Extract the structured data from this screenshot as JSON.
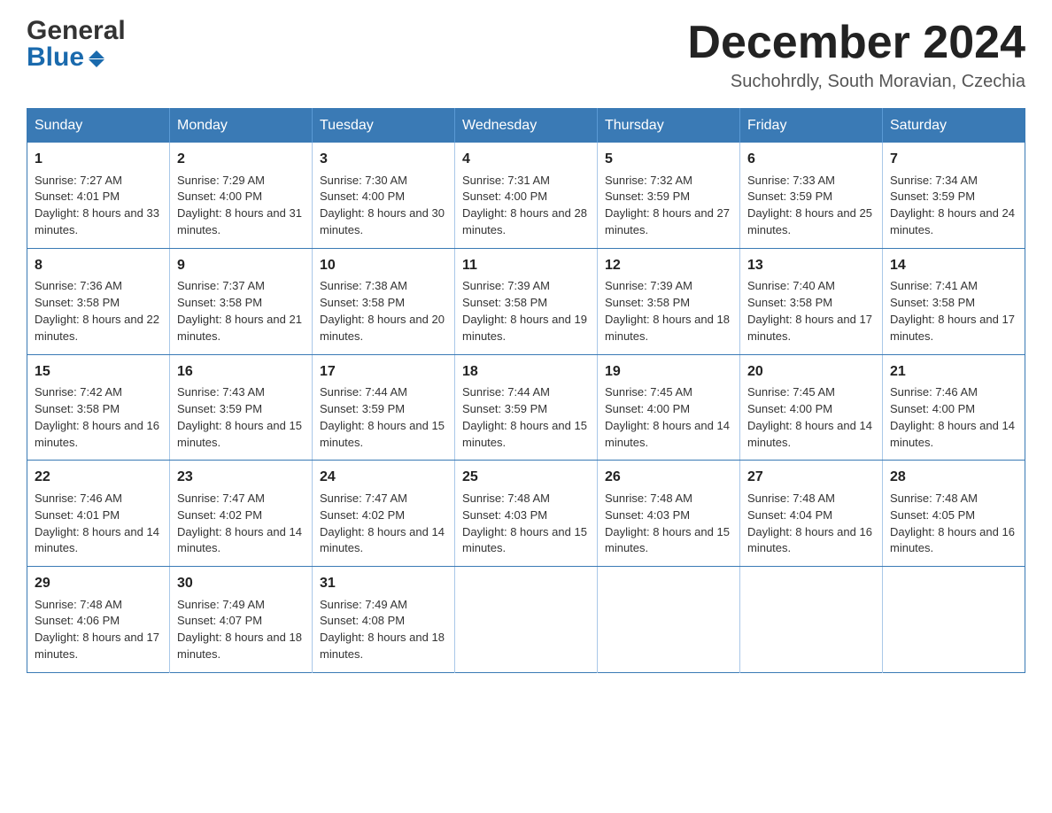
{
  "header": {
    "logo_line1": "General",
    "logo_line2": "Blue",
    "month_title": "December 2024",
    "location": "Suchohrdly, South Moravian, Czechia"
  },
  "weekdays": [
    "Sunday",
    "Monday",
    "Tuesday",
    "Wednesday",
    "Thursday",
    "Friday",
    "Saturday"
  ],
  "weeks": [
    [
      {
        "day": "1",
        "sunrise": "Sunrise: 7:27 AM",
        "sunset": "Sunset: 4:01 PM",
        "daylight": "Daylight: 8 hours and 33 minutes."
      },
      {
        "day": "2",
        "sunrise": "Sunrise: 7:29 AM",
        "sunset": "Sunset: 4:00 PM",
        "daylight": "Daylight: 8 hours and 31 minutes."
      },
      {
        "day": "3",
        "sunrise": "Sunrise: 7:30 AM",
        "sunset": "Sunset: 4:00 PM",
        "daylight": "Daylight: 8 hours and 30 minutes."
      },
      {
        "day": "4",
        "sunrise": "Sunrise: 7:31 AM",
        "sunset": "Sunset: 4:00 PM",
        "daylight": "Daylight: 8 hours and 28 minutes."
      },
      {
        "day": "5",
        "sunrise": "Sunrise: 7:32 AM",
        "sunset": "Sunset: 3:59 PM",
        "daylight": "Daylight: 8 hours and 27 minutes."
      },
      {
        "day": "6",
        "sunrise": "Sunrise: 7:33 AM",
        "sunset": "Sunset: 3:59 PM",
        "daylight": "Daylight: 8 hours and 25 minutes."
      },
      {
        "day": "7",
        "sunrise": "Sunrise: 7:34 AM",
        "sunset": "Sunset: 3:59 PM",
        "daylight": "Daylight: 8 hours and 24 minutes."
      }
    ],
    [
      {
        "day": "8",
        "sunrise": "Sunrise: 7:36 AM",
        "sunset": "Sunset: 3:58 PM",
        "daylight": "Daylight: 8 hours and 22 minutes."
      },
      {
        "day": "9",
        "sunrise": "Sunrise: 7:37 AM",
        "sunset": "Sunset: 3:58 PM",
        "daylight": "Daylight: 8 hours and 21 minutes."
      },
      {
        "day": "10",
        "sunrise": "Sunrise: 7:38 AM",
        "sunset": "Sunset: 3:58 PM",
        "daylight": "Daylight: 8 hours and 20 minutes."
      },
      {
        "day": "11",
        "sunrise": "Sunrise: 7:39 AM",
        "sunset": "Sunset: 3:58 PM",
        "daylight": "Daylight: 8 hours and 19 minutes."
      },
      {
        "day": "12",
        "sunrise": "Sunrise: 7:39 AM",
        "sunset": "Sunset: 3:58 PM",
        "daylight": "Daylight: 8 hours and 18 minutes."
      },
      {
        "day": "13",
        "sunrise": "Sunrise: 7:40 AM",
        "sunset": "Sunset: 3:58 PM",
        "daylight": "Daylight: 8 hours and 17 minutes."
      },
      {
        "day": "14",
        "sunrise": "Sunrise: 7:41 AM",
        "sunset": "Sunset: 3:58 PM",
        "daylight": "Daylight: 8 hours and 17 minutes."
      }
    ],
    [
      {
        "day": "15",
        "sunrise": "Sunrise: 7:42 AM",
        "sunset": "Sunset: 3:58 PM",
        "daylight": "Daylight: 8 hours and 16 minutes."
      },
      {
        "day": "16",
        "sunrise": "Sunrise: 7:43 AM",
        "sunset": "Sunset: 3:59 PM",
        "daylight": "Daylight: 8 hours and 15 minutes."
      },
      {
        "day": "17",
        "sunrise": "Sunrise: 7:44 AM",
        "sunset": "Sunset: 3:59 PM",
        "daylight": "Daylight: 8 hours and 15 minutes."
      },
      {
        "day": "18",
        "sunrise": "Sunrise: 7:44 AM",
        "sunset": "Sunset: 3:59 PM",
        "daylight": "Daylight: 8 hours and 15 minutes."
      },
      {
        "day": "19",
        "sunrise": "Sunrise: 7:45 AM",
        "sunset": "Sunset: 4:00 PM",
        "daylight": "Daylight: 8 hours and 14 minutes."
      },
      {
        "day": "20",
        "sunrise": "Sunrise: 7:45 AM",
        "sunset": "Sunset: 4:00 PM",
        "daylight": "Daylight: 8 hours and 14 minutes."
      },
      {
        "day": "21",
        "sunrise": "Sunrise: 7:46 AM",
        "sunset": "Sunset: 4:00 PM",
        "daylight": "Daylight: 8 hours and 14 minutes."
      }
    ],
    [
      {
        "day": "22",
        "sunrise": "Sunrise: 7:46 AM",
        "sunset": "Sunset: 4:01 PM",
        "daylight": "Daylight: 8 hours and 14 minutes."
      },
      {
        "day": "23",
        "sunrise": "Sunrise: 7:47 AM",
        "sunset": "Sunset: 4:02 PM",
        "daylight": "Daylight: 8 hours and 14 minutes."
      },
      {
        "day": "24",
        "sunrise": "Sunrise: 7:47 AM",
        "sunset": "Sunset: 4:02 PM",
        "daylight": "Daylight: 8 hours and 14 minutes."
      },
      {
        "day": "25",
        "sunrise": "Sunrise: 7:48 AM",
        "sunset": "Sunset: 4:03 PM",
        "daylight": "Daylight: 8 hours and 15 minutes."
      },
      {
        "day": "26",
        "sunrise": "Sunrise: 7:48 AM",
        "sunset": "Sunset: 4:03 PM",
        "daylight": "Daylight: 8 hours and 15 minutes."
      },
      {
        "day": "27",
        "sunrise": "Sunrise: 7:48 AM",
        "sunset": "Sunset: 4:04 PM",
        "daylight": "Daylight: 8 hours and 16 minutes."
      },
      {
        "day": "28",
        "sunrise": "Sunrise: 7:48 AM",
        "sunset": "Sunset: 4:05 PM",
        "daylight": "Daylight: 8 hours and 16 minutes."
      }
    ],
    [
      {
        "day": "29",
        "sunrise": "Sunrise: 7:48 AM",
        "sunset": "Sunset: 4:06 PM",
        "daylight": "Daylight: 8 hours and 17 minutes."
      },
      {
        "day": "30",
        "sunrise": "Sunrise: 7:49 AM",
        "sunset": "Sunset: 4:07 PM",
        "daylight": "Daylight: 8 hours and 18 minutes."
      },
      {
        "day": "31",
        "sunrise": "Sunrise: 7:49 AM",
        "sunset": "Sunset: 4:08 PM",
        "daylight": "Daylight: 8 hours and 18 minutes."
      },
      null,
      null,
      null,
      null
    ]
  ]
}
